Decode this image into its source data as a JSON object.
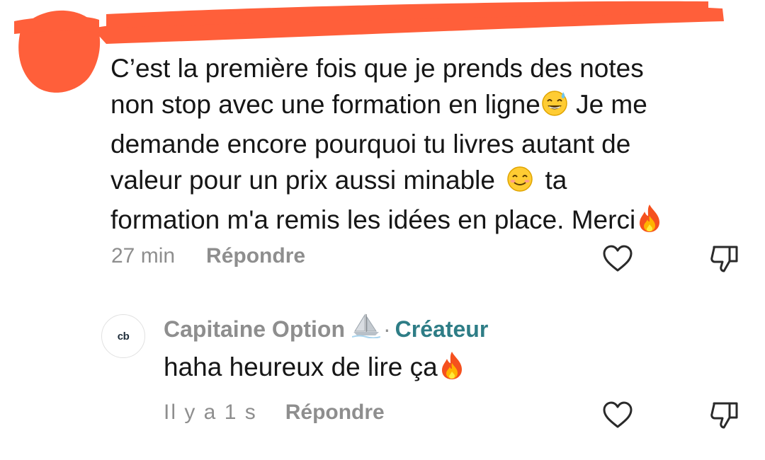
{
  "comment": {
    "lines": [
      "C’est la première fois que je prends des notes",
      "non stop avec une formation en ligne",
      " Je me",
      "demande encore pourquoi tu livres autant de",
      "valeur pour un prix aussi minable ",
      " ta",
      "formation m'a remis les idées en place. Merci"
    ],
    "emojis": [
      "sweat-smile-emoji-icon",
      "smiling-face-emoji-icon",
      "fire-emoji-icon"
    ],
    "time": "27 min",
    "reply_label": "Répondre",
    "actions": [
      "heart-icon",
      "thumbs-down-icon"
    ]
  },
  "reply": {
    "avatar_text": "cb",
    "author": "Capitaine Option",
    "author_icon": "sailboat-icon",
    "separator": "·",
    "badge": "Créateur",
    "text": "haha heureux de lire ça",
    "emojis": [
      "fire-emoji-icon"
    ],
    "time": "Il y a 1 s",
    "reply_label": "Répondre",
    "actions": [
      "heart-icon",
      "thumbs-down-icon"
    ]
  },
  "colors": {
    "redaction": "#ff5f3a",
    "text": "#161616",
    "muted": "#8e8e8e",
    "creator_badge": "#2e7d86",
    "icon_stroke": "#2a2a2a"
  }
}
